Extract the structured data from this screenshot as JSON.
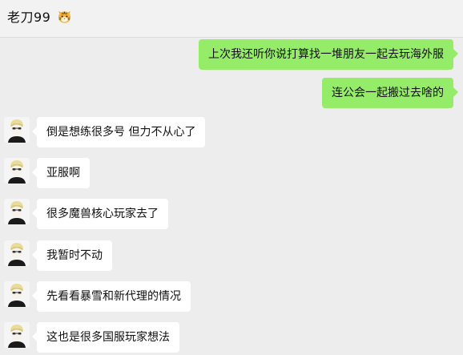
{
  "header": {
    "title": "老刀99",
    "title_emoji": "tiger-face-emoji"
  },
  "colors": {
    "outgoing_bubble": "#95ec69",
    "incoming_bubble": "#ffffff",
    "background": "#ededed"
  },
  "messages": [
    {
      "side": "out",
      "text": "上次我还听你说打算找一堆朋友一起去玩海外服"
    },
    {
      "side": "out",
      "text": "连公会一起搬过去啥的"
    },
    {
      "side": "in",
      "text": "倒是想练很多号 但力不从心了"
    },
    {
      "side": "in",
      "text": "亚服啊"
    },
    {
      "side": "in",
      "text": "很多魔兽核心玩家去了"
    },
    {
      "side": "in",
      "text": "我暂时不动"
    },
    {
      "side": "in",
      "text": "先看看暴雪和新代理的情况"
    },
    {
      "side": "in",
      "text": "这也是很多国服玩家想法"
    }
  ]
}
